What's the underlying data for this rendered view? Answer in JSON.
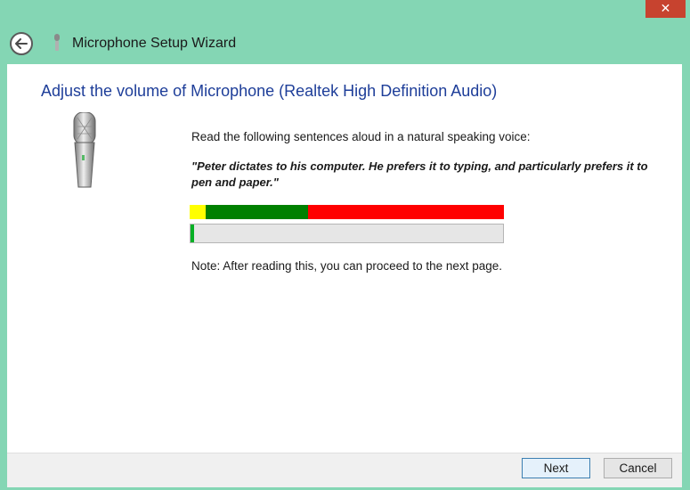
{
  "window": {
    "title": "Microphone Setup Wizard",
    "close_label": "✕"
  },
  "main": {
    "heading": "Adjust the volume of Microphone (Realtek High Definition Audio)",
    "instructions": "Read the following sentences aloud in a natural speaking voice:",
    "quote": "\"Peter dictates to his computer. He prefers it to typing, and particularly prefers it to pen and paper.\"",
    "note": "Note: After reading this, you can proceed to the next page.",
    "level_meter": {
      "fill_fraction": 0.01
    }
  },
  "footer": {
    "next_label": "Next",
    "cancel_label": "Cancel"
  },
  "colors": {
    "background": "#84d6b4",
    "heading": "#1e3e99",
    "level_low": "#ffff00",
    "level_ok": "#008000",
    "level_high": "#ff0000",
    "meter_fill": "#06b025",
    "close": "#c7432f"
  },
  "icons": [
    "back-arrow-icon",
    "microphone-icon",
    "close-icon"
  ]
}
